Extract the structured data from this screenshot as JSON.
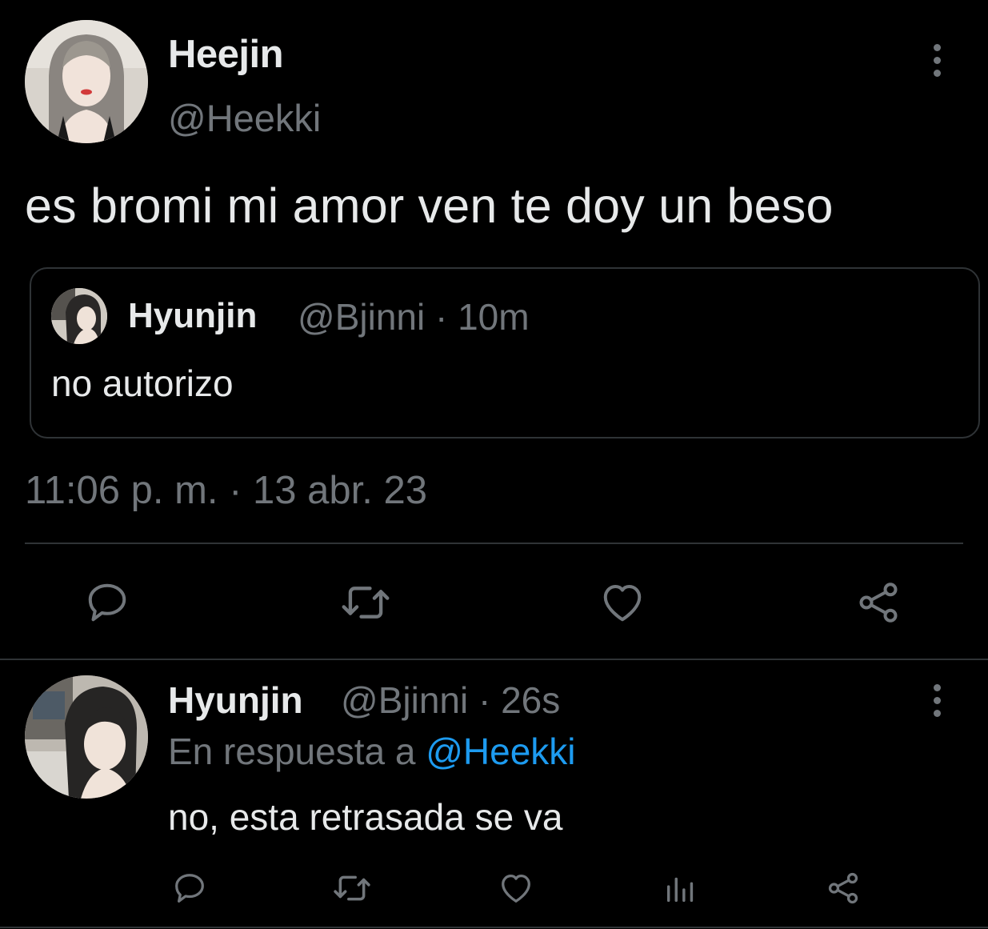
{
  "theme": {
    "background": "#000000",
    "text_primary": "#e7e9ea",
    "text_secondary": "#71767b",
    "accent": "#1d9bf0",
    "border": "#2f3336"
  },
  "main_tweet": {
    "author": {
      "name": "Heejin",
      "handle": "@Heekki"
    },
    "text": "es bromi mi amor ven te doy un beso",
    "quoted_tweet": {
      "author_name": "Hyunjin",
      "meta": "@Bjinni · 10m",
      "text": "no autorizo"
    },
    "timestamp": "11:06 p. m. · 13 abr. 23",
    "actions": [
      "reply-icon",
      "retweet-icon",
      "like-icon",
      "share-icon"
    ],
    "more_icon": "more-vertical-icon"
  },
  "reply_tweet": {
    "author": {
      "name": "Hyunjin",
      "meta": "@Bjinni · 26s"
    },
    "reply_context_prefix": "En respuesta a ",
    "reply_context_mention": "@Heekki",
    "text": "no, esta retrasada se va",
    "actions": [
      "reply-icon",
      "retweet-icon",
      "like-icon",
      "analytics-icon",
      "share-icon"
    ],
    "more_icon": "more-vertical-icon"
  }
}
